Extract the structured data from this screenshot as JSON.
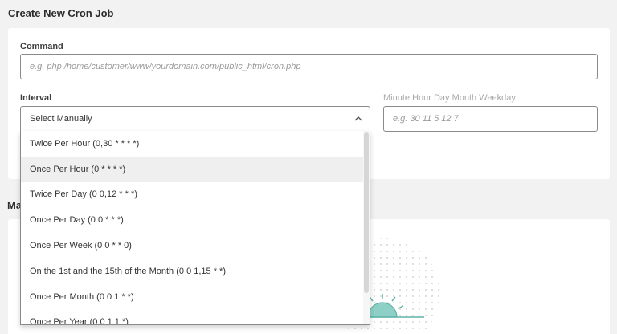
{
  "page": {
    "title": "Create New Cron Job",
    "manage_title_partial": "Ma"
  },
  "command": {
    "label": "Command",
    "placeholder": "e.g. php /home/customer/www/yourdomain.com/public_html/cron.php"
  },
  "interval": {
    "label": "Interval",
    "selected": "Select Manually",
    "options": [
      "Twice Per Hour (0,30 * * * *)",
      "Once Per Hour (0 * * * *)",
      "Twice Per Day (0 0,12 * * *)",
      "Once Per Day (0 0 * * *)",
      "Once Per Week (0 0 * * 0)",
      "On the 1st and the 15th of the Month (0 0 1,15 * *)",
      "Once Per Month (0 0 1 * *)",
      "Once Per Year (0 0 1 1 *)"
    ],
    "hovered_index": 1
  },
  "manual": {
    "label": "Minute Hour Day Month Weekday",
    "placeholder": "e.g. 30 11 5 12 7"
  },
  "icons": [
    "chevron-up-icon"
  ],
  "colors": {
    "background": "#f2f2f2",
    "card": "#ffffff",
    "border": "#8a8a8a",
    "hover": "#efefef",
    "accent": "#5fb3a8"
  }
}
